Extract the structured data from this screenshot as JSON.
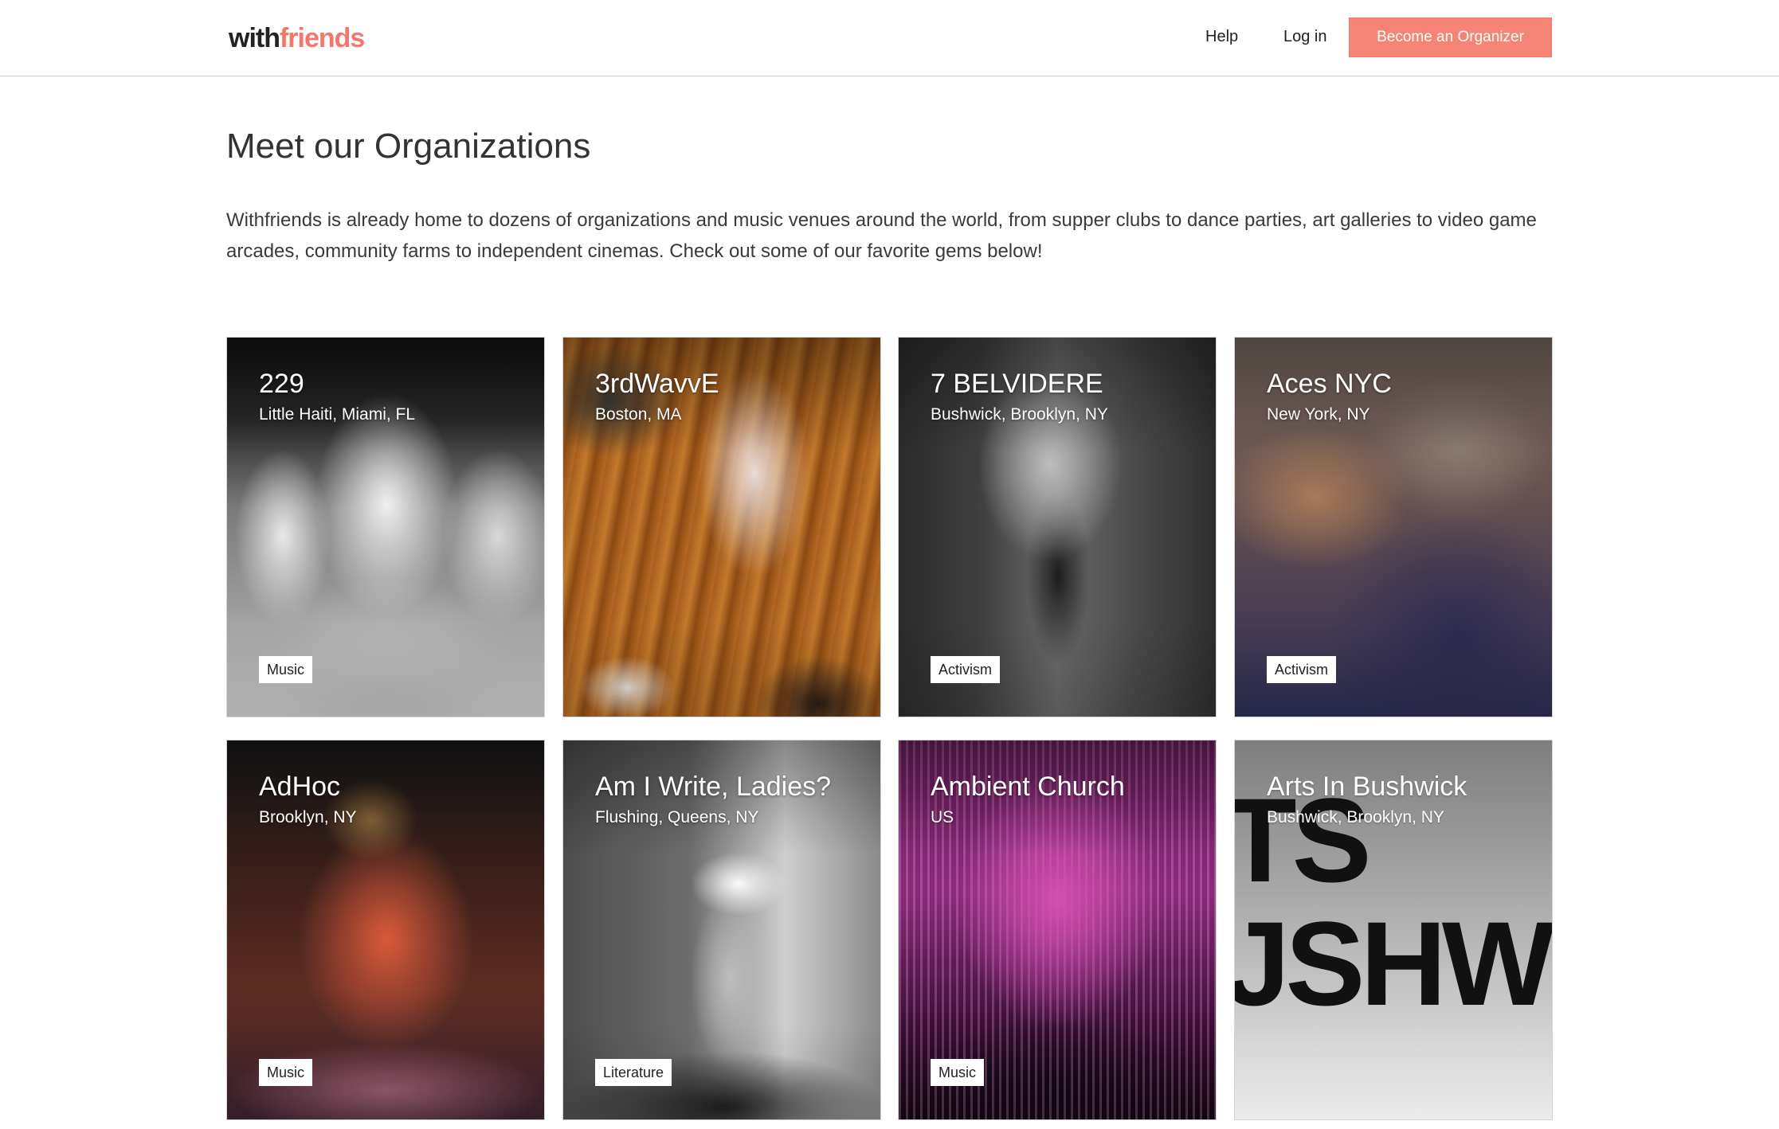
{
  "header": {
    "logo_part1": "with",
    "logo_part2": "friends",
    "nav_help": "Help",
    "nav_login": "Log in",
    "cta_label": "Become an Organizer"
  },
  "colors": {
    "accent": "#f68476",
    "text": "#333333"
  },
  "page": {
    "title": "Meet our Organizations",
    "intro": "Withfriends is already home to dozens of organizations and music venues around the world, from supper clubs to dance parties, art galleries to video game arcades, community farms to independent cinemas. Check out some of our favorite gems below!"
  },
  "orgs": [
    {
      "name": "229",
      "location": "Little Haiti, Miami, FL",
      "tag": "Music"
    },
    {
      "name": "3rdWavvE",
      "location": "Boston, MA",
      "tag": ""
    },
    {
      "name": "7 BELVIDERE",
      "location": "Bushwick, Brooklyn, NY",
      "tag": "Activism"
    },
    {
      "name": "Aces NYC",
      "location": "New York, NY",
      "tag": "Activism"
    },
    {
      "name": "AdHoc",
      "location": "Brooklyn, NY",
      "tag": "Music"
    },
    {
      "name": "Am I Write, Ladies?",
      "location": "Flushing, Queens, NY",
      "tag": "Literature"
    },
    {
      "name": "Ambient Church",
      "location": "US",
      "tag": "Music"
    },
    {
      "name": "Arts In Bushwick",
      "location": "Bushwick, Brooklyn, NY",
      "tag": "",
      "logo_text_1": "TS",
      "logo_text_2": "JSHW"
    }
  ]
}
